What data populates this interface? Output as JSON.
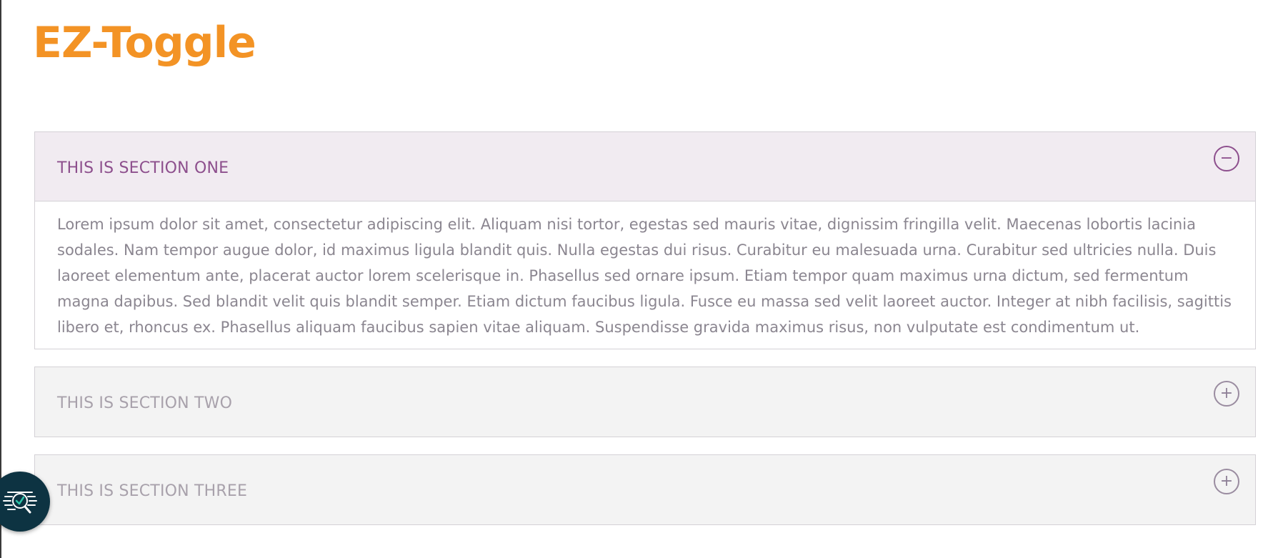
{
  "page": {
    "title": "EZ-Toggle"
  },
  "accordion": {
    "sections": [
      {
        "title": "THIS IS SECTION ONE",
        "expanded": true,
        "icon": "minus-circle-icon",
        "body": "Lorem ipsum dolor sit amet, consectetur adipiscing elit. Aliquam nisi tortor, egestas sed mauris vitae, dignissim fringilla velit. Maecenas lobortis lacinia sodales. Nam tempor augue dolor, id maximus ligula blandit quis. Nulla egestas dui risus. Curabitur eu malesuada urna. Curabitur sed ultricies nulla. Duis laoreet elementum ante, placerat auctor lorem scelerisque in. Phasellus sed ornare ipsum. Etiam tempor quam maximus urna dictum, sed fermentum magna dapibus. Sed blandit velit quis blandit semper. Etiam dictum faucibus ligula. Fusce eu massa sed velit laoreet auctor. Integer at nibh facilisis, sagittis libero et, rhoncus ex. Phasellus aliquam faucibus sapien vitae aliquam. Suspendisse gravida maximus risus, non vulputate est condimentum ut."
      },
      {
        "title": "THIS IS SECTION TWO",
        "expanded": false,
        "icon": "plus-circle-icon"
      },
      {
        "title": "THIS IS SECTION THREE",
        "expanded": false,
        "icon": "plus-circle-icon"
      }
    ],
    "expand_glyph": "+",
    "collapse_glyph": "−"
  },
  "accessibility_badge": {
    "icon": "accessibility-check-icon"
  },
  "colors": {
    "title": "#f39325",
    "active_section_text": "#8d4f8d",
    "active_section_bg": "#f1ebf1",
    "inactive_section_text": "#a8a1ab",
    "inactive_section_bg": "#f3f3f3",
    "body_text": "#8b8690",
    "badge_bg": "#0d3342",
    "badge_accent": "#2bc4a8"
  }
}
